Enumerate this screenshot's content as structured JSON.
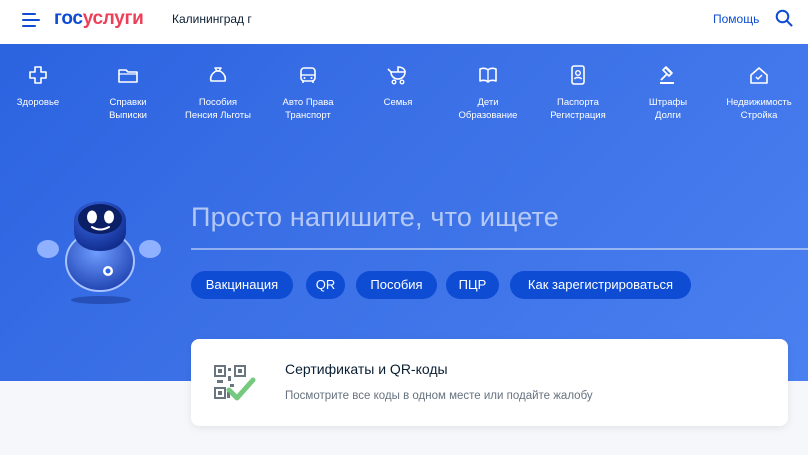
{
  "header": {
    "logo_part1": "гос",
    "logo_part2": "услуги",
    "region": "Калининград г",
    "help": "Помощь"
  },
  "categories": [
    {
      "label": "Здоровье",
      "icon": "health-cross-icon"
    },
    {
      "label": "Справки\nВыписки",
      "icon": "folder-icon"
    },
    {
      "label": "Пособия\nПенсия Льготы",
      "icon": "money-bag-icon"
    },
    {
      "label": "Авто Права\nТранспорт",
      "icon": "car-icon"
    },
    {
      "label": "Семья",
      "icon": "stroller-icon"
    },
    {
      "label": "Дети\nОбразование",
      "icon": "book-icon"
    },
    {
      "label": "Паспорта\nРегистрация",
      "icon": "passport-icon"
    },
    {
      "label": "Штрафы\nДолги",
      "icon": "gavel-icon"
    },
    {
      "label": "Недвижимость\nСтройка",
      "icon": "house-icon"
    }
  ],
  "search": {
    "prompt": "Просто напишите, что ищете"
  },
  "chips": [
    "Вакцинация",
    "QR",
    "Пособия",
    "ПЦР",
    "Как зарегистрироваться"
  ],
  "card": {
    "title": "Сертификаты и QR-коды",
    "subtitle": "Посмотрите все коды в одном месте или подайте жалобу",
    "icon": "qr-check-icon"
  },
  "colors": {
    "brand_blue": "#0d4cd3",
    "brand_red": "#ee3f58",
    "hero_bg": "#3a6fe6"
  }
}
